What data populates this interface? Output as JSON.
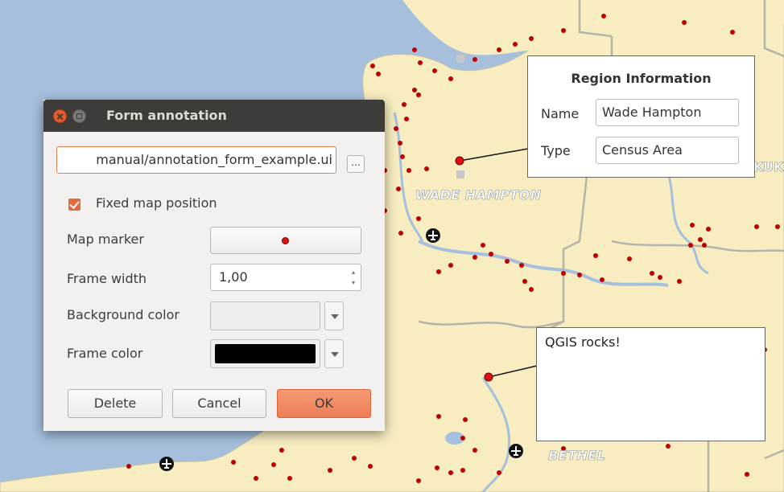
{
  "map": {
    "labels": {
      "wade_hampton": "WADE HAMPTON",
      "bethel": "BETHEL",
      "kuk": "KUK"
    },
    "colors": {
      "water": "#a5bfdd",
      "land": "#f7edc0",
      "border": "#b5b3ab",
      "point": "#cc0000"
    }
  },
  "region_annotation": {
    "title": "Region Information",
    "name_label": "Name",
    "name_value": "Wade Hampton",
    "type_label": "Type",
    "type_value": "Census Area"
  },
  "text_annotation": {
    "text": "QGIS rocks!"
  },
  "dialog": {
    "title": "Form annotation",
    "file_path": "manual/annotation_form_example.ui",
    "browse_label": "...",
    "fixed_position_label": "Fixed map position",
    "fixed_position_checked": true,
    "map_marker_label": "Map marker",
    "frame_width_label": "Frame width",
    "frame_width_value": "1,00",
    "background_color_label": "Background color",
    "background_color": "#eeeeec",
    "frame_color_label": "Frame color",
    "frame_color": "#000000",
    "delete_label": "Delete",
    "cancel_label": "Cancel",
    "ok_label": "OK"
  }
}
